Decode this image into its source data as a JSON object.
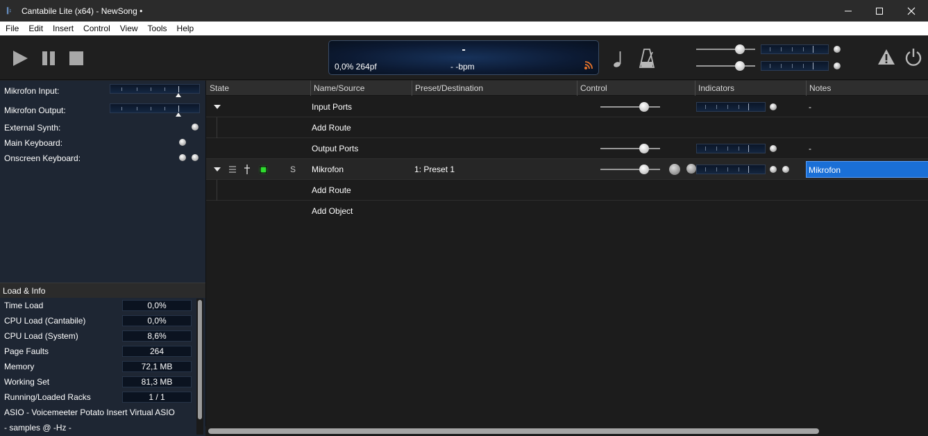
{
  "window": {
    "title": "Cantabile Lite (x64) - NewSong •",
    "minimize": "—",
    "maximize": "☐",
    "close": "✕"
  },
  "menu": [
    "File",
    "Edit",
    "Insert",
    "Control",
    "View",
    "Tools",
    "Help"
  ],
  "transport": {
    "song_position": "-",
    "load_display": "0,0%  264pf",
    "tempo_display": "- -bpm"
  },
  "left_bindings": [
    {
      "label": "Mikrofon Input:",
      "type": "meter",
      "level": 0.75
    },
    {
      "label": "Mikrofon Output:",
      "type": "meter",
      "level": 0.75
    },
    {
      "label": "External Synth:",
      "type": "led"
    },
    {
      "label": "Main Keyboard:",
      "type": "led"
    },
    {
      "label": "Onscreen Keyboard:",
      "type": "led2"
    }
  ],
  "load_info": {
    "header": "Load & Info",
    "rows": [
      {
        "label": "Time Load",
        "value": "0,0%"
      },
      {
        "label": "CPU Load (Cantabile)",
        "value": "0,0%"
      },
      {
        "label": "CPU Load (System)",
        "value": "8,6%"
      },
      {
        "label": "Page Faults",
        "value": "264"
      },
      {
        "label": "Memory",
        "value": "72,1 MB"
      },
      {
        "label": "Working Set",
        "value": "81,3 MB"
      },
      {
        "label": "Running/Loaded Racks",
        "value": "1 / 1"
      }
    ],
    "driver": "ASIO - Voicemeeter Potato Insert Virtual ASIO",
    "samples": "- samples @ -Hz -"
  },
  "columns": [
    "State",
    "Name/Source",
    "Preset/Destination",
    "Control",
    "Indicators",
    "Notes"
  ],
  "rows": [
    {
      "name": "Input Ports",
      "preset": "",
      "notes": "-"
    },
    {
      "name": "Add Route",
      "preset": "",
      "notes": ""
    },
    {
      "name": "Output Ports",
      "preset": "",
      "notes": "-"
    },
    {
      "name": "Mikrofon",
      "preset": "1: Preset 1",
      "notes": "Mikrofon",
      "solo": "S"
    },
    {
      "name": "Add Route",
      "preset": "",
      "notes": ""
    },
    {
      "name": "Add Object",
      "preset": "",
      "notes": ""
    }
  ],
  "colors": {
    "accent": "#1a6fd6",
    "lcd_bg": "#0c1a33",
    "panel_bg": "#1e2633",
    "active_led": "#2edc2e",
    "rss_orange": "#e8742a"
  },
  "icons": [
    "app-icon",
    "play-icon",
    "pause-icon",
    "stop-icon",
    "note-icon",
    "metronome-icon",
    "warning-icon",
    "power-icon",
    "rss-icon"
  ]
}
